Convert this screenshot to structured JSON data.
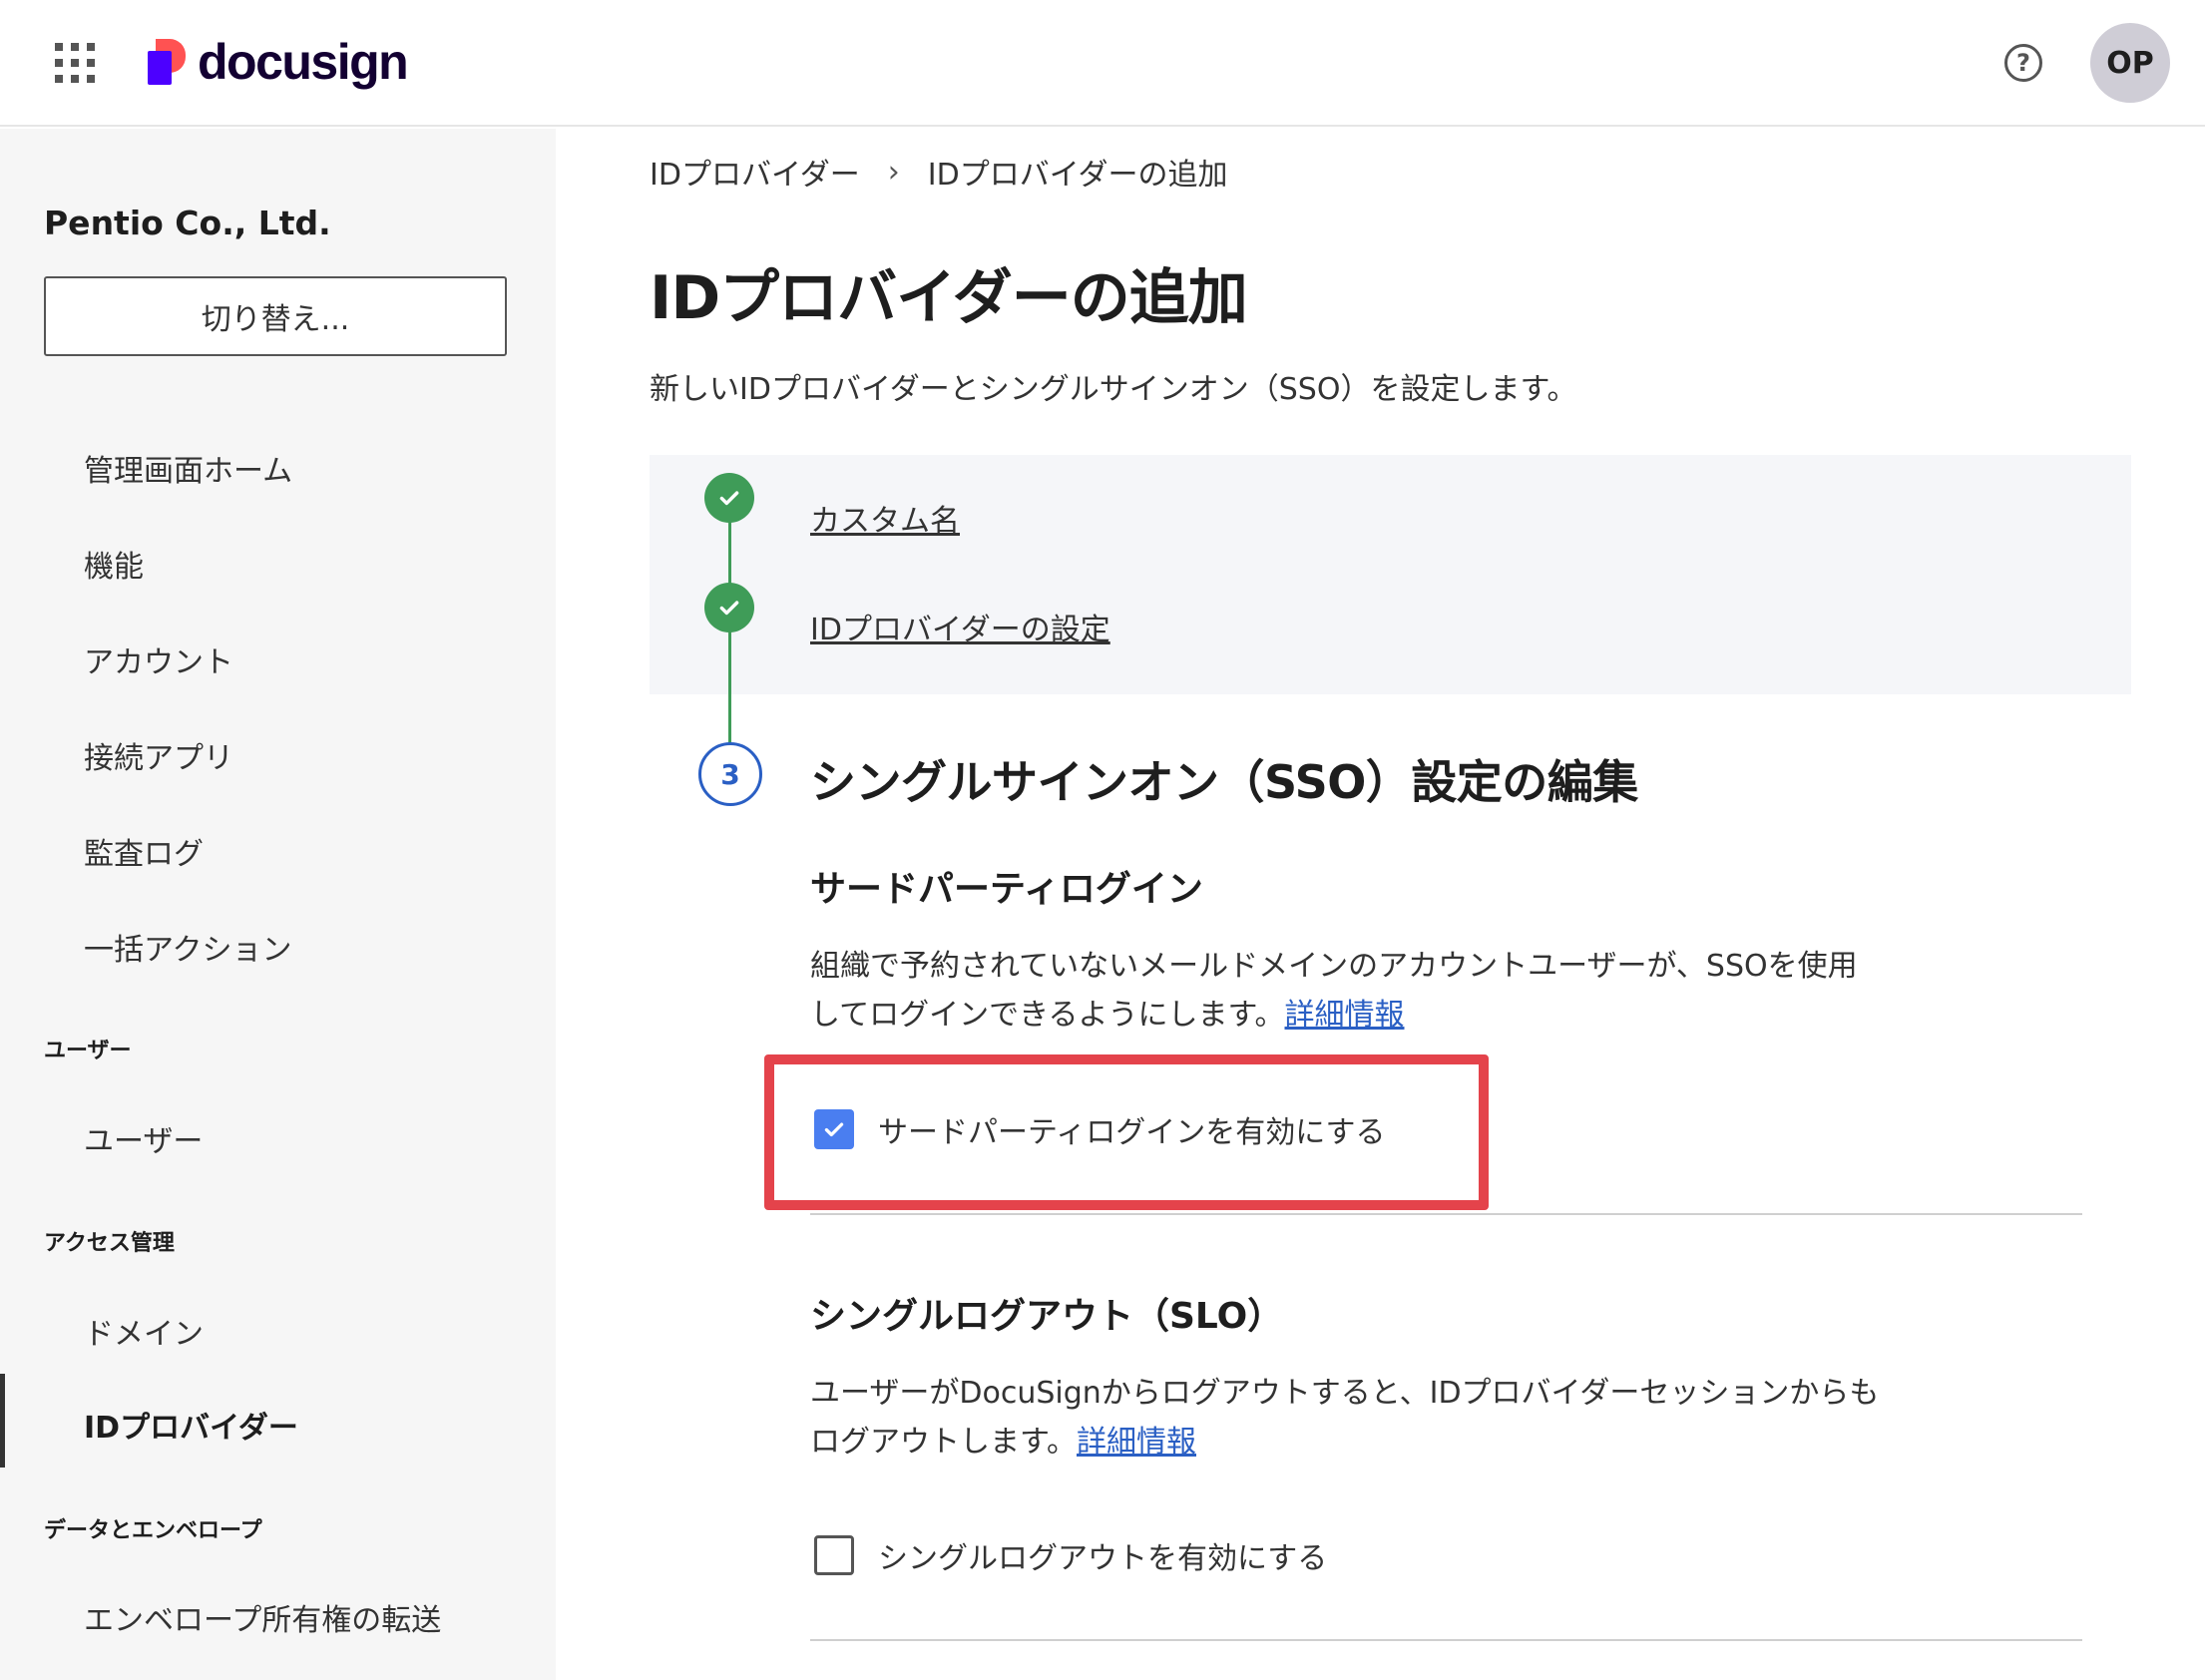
{
  "header": {
    "brand": "docusign",
    "avatar_initials": "OP",
    "help_glyph": "?"
  },
  "sidebar": {
    "org_name": "Pentio Co., Ltd.",
    "switch_label": "切り替え...",
    "items": [
      {
        "label": "管理画面ホーム"
      },
      {
        "label": "機能"
      },
      {
        "label": "アカウント"
      },
      {
        "label": "接続アプリ"
      },
      {
        "label": "監査ログ"
      },
      {
        "label": "一括アクション"
      }
    ],
    "section_users": "ユーザー",
    "users_item": "ユーザー",
    "section_access": "アクセス管理",
    "domain_item": "ドメイン",
    "idp_item": "IDプロバイダー",
    "section_data": "データとエンベロープ",
    "envelope_item": "エンベロープ所有権の転送"
  },
  "breadcrumb": {
    "parent": "IDプロバイダー",
    "current": "IDプロバイダーの追加"
  },
  "page": {
    "title": "IDプロバイダーの追加",
    "description": "新しいIDプロバイダーとシングルサインオン（SSO）を設定します。"
  },
  "steps": {
    "step1": "カスタム名",
    "step2": "IDプロバイダーの設定",
    "step3_number": "3",
    "step3_title": "シングルサインオン（SSO）設定の編集"
  },
  "third_party": {
    "title": "サードパーティログイン",
    "line1": "組織で予約されていないメールドメインのアカウントユーザーが、SSOを使用",
    "line2": "してログインできるようにします。",
    "link": "詳細情報",
    "checkbox_label": "サードパーティログインを有効にする",
    "checked": true
  },
  "slo": {
    "title": "シングルログアウト（SLO）",
    "line1": "ユーザーがDocuSignからログアウトすると、IDプロバイダーセッションからも",
    "line2": "ログアウトします。",
    "link": "詳細情報",
    "checkbox_label": "シングルログアウトを有効にする",
    "checked": false
  },
  "colors": {
    "step_done": "#3f9c58",
    "step_current": "#2a5fc4",
    "checkbox_checked": "#4a7ef0",
    "highlight": "#e4434b",
    "link": "#2a5fc4"
  }
}
